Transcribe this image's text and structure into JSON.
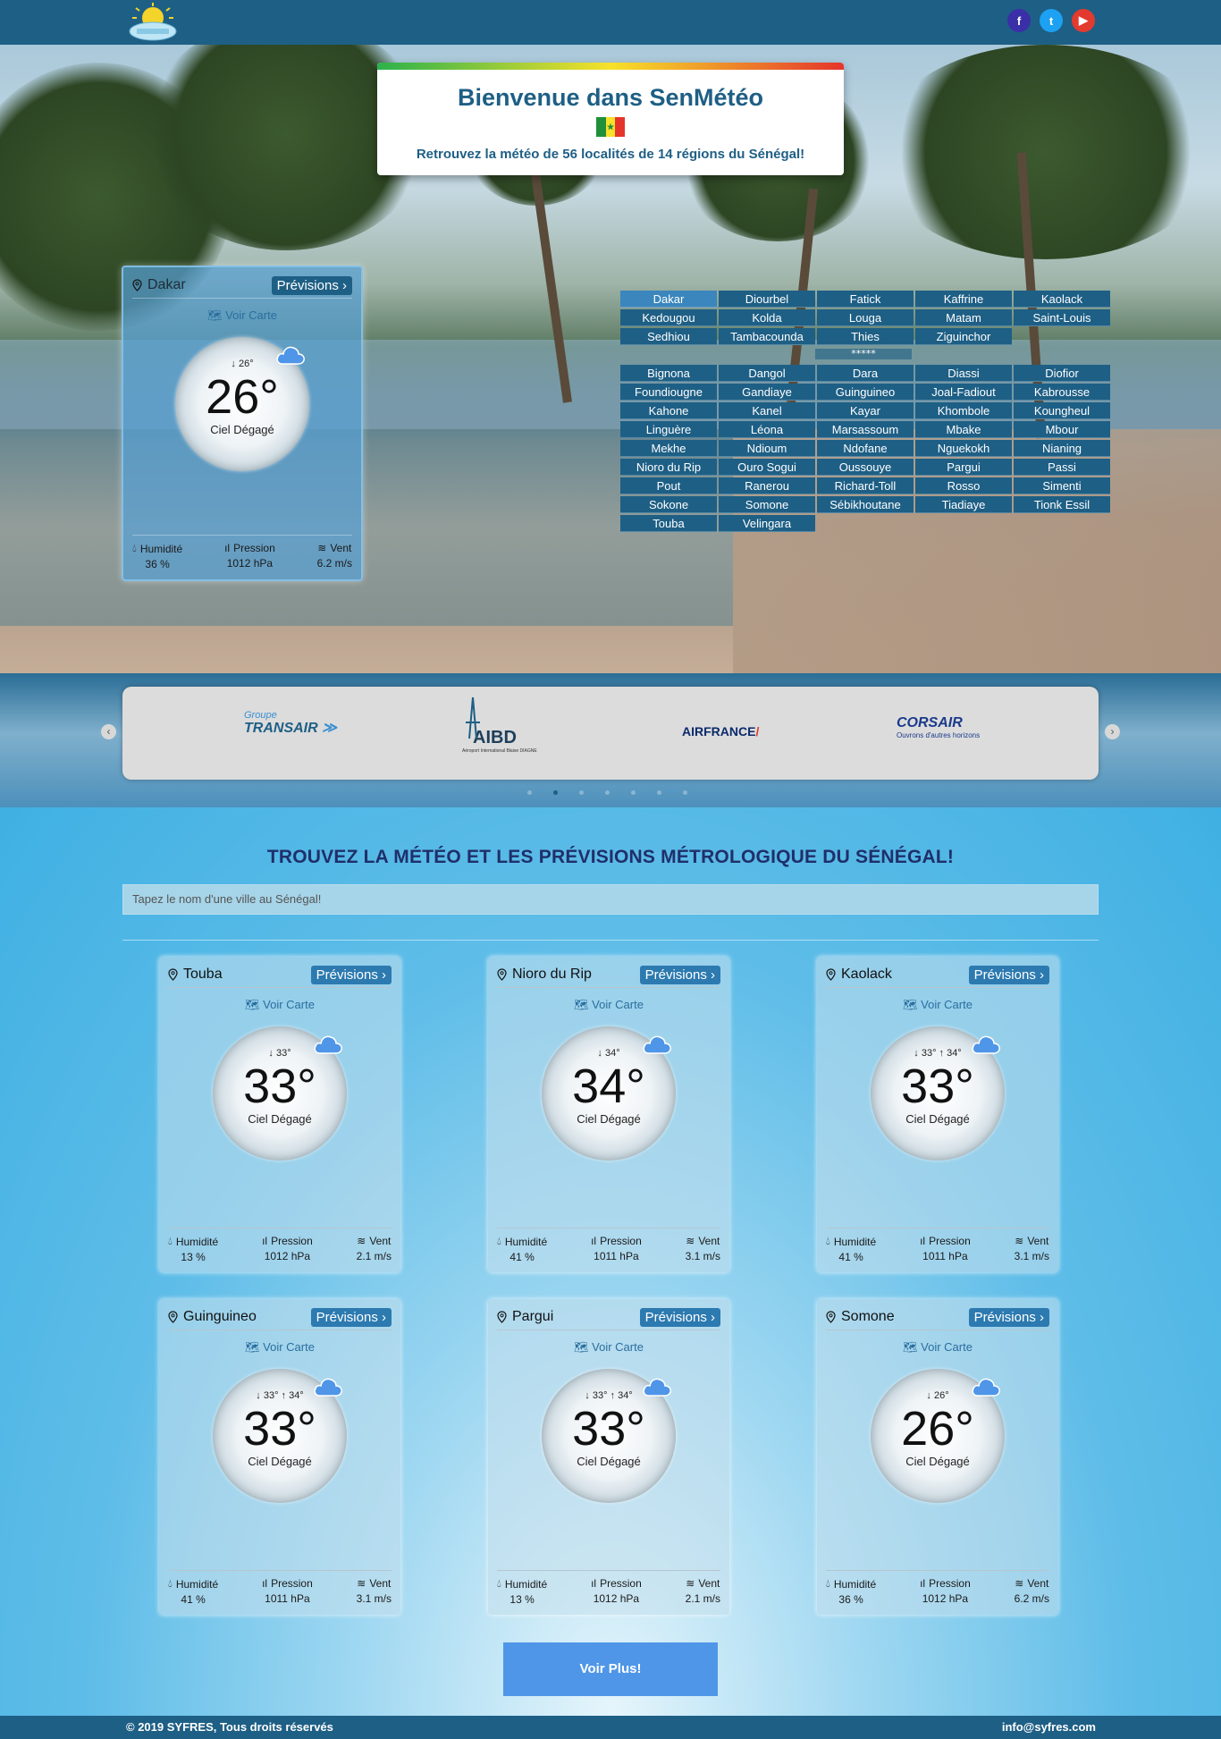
{
  "social": [
    {
      "icon": "facebook-icon",
      "glyph": "f",
      "color": "#3b2fa8"
    },
    {
      "icon": "twitter-icon",
      "glyph": "t",
      "color": "#1da1f2"
    },
    {
      "icon": "youtube-icon",
      "glyph": "▶",
      "color": "#e33a2f"
    }
  ],
  "welcome": {
    "title": "Bienvenue dans SenMétéo",
    "subtitle": "Retrouvez la météo de 56 localités de 14 régions du Sénégal!"
  },
  "regions": [
    "Dakar",
    "Diourbel",
    "Fatick",
    "Kaffrine",
    "Kaolack",
    "Kedougou",
    "Kolda",
    "Louga",
    "Matam",
    "Saint-Louis",
    "Sedhiou",
    "Tambacounda",
    "Thies",
    "Ziguinchor"
  ],
  "separator": "*****",
  "localities": [
    "Bignona",
    "Dangol",
    "Dara",
    "Diassi",
    "Diofior",
    "Foundiougne",
    "Gandiaye",
    "Guinguineo",
    "Joal-Fadiout",
    "Kabrousse",
    "Kahone",
    "Kanel",
    "Kayar",
    "Khombole",
    "Koungheul",
    "Linguère",
    "Léona",
    "Marsassoum",
    "Mbake",
    "Mbour",
    "Mekhe",
    "Ndioum",
    "Ndofane",
    "Nguekokh",
    "Nianing",
    "Nioro du Rip",
    "Ouro Sogui",
    "Oussouye",
    "Pargui",
    "Passi",
    "Pout",
    "Ranerou",
    "Richard-Toll",
    "Rosso",
    "Simenti",
    "Sokone",
    "Somone",
    "Sébikhoutane",
    "Tiadiaye",
    "Tionk Essil",
    "Touba",
    "Velingara"
  ],
  "labels": {
    "previsions": "Prévisions",
    "voir_carte": "Voir Carte",
    "humidite": "Humidité",
    "pression": "Pression",
    "vent": "Vent"
  },
  "hero_card": {
    "city": "Dakar",
    "minmax": "26°",
    "temp": "26°",
    "desc": "Ciel Dégagé",
    "humidity": "36 %",
    "pressure": "1012 hPa",
    "wind": "6.2 m/s"
  },
  "partners": [
    "Groupe",
    "TRANSAIR",
    "AIBD",
    "Aéroport International Blaise DIAGNE",
    "AIRFRANCE",
    "CORSAIR",
    "Ouvrons d'autres horizons"
  ],
  "search": {
    "heading": "TROUVEZ LA MÉTÉO ET LES PRÉVISIONS MÉTROLOGIQUE DU SÉNÉGAL!",
    "placeholder": "Tapez le nom d'une ville au Sénégal!"
  },
  "cards": [
    {
      "city": "Touba",
      "minmax": "33°",
      "temp": "33°",
      "desc": "Ciel Dégagé",
      "humidity": "13 %",
      "pressure": "1012 hPa",
      "wind": "2.1 m/s"
    },
    {
      "city": "Nioro du Rip",
      "minmax": "34°",
      "temp": "34°",
      "desc": "Ciel Dégagé",
      "humidity": "41 %",
      "pressure": "1011 hPa",
      "wind": "3.1 m/s"
    },
    {
      "city": "Kaolack",
      "minmax": "33° ↑ 34°",
      "temp": "33°",
      "desc": "Ciel Dégagé",
      "humidity": "41 %",
      "pressure": "1011 hPa",
      "wind": "3.1 m/s"
    },
    {
      "city": "Guinguineo",
      "minmax": "33° ↑ 34°",
      "temp": "33°",
      "desc": "Ciel Dégagé",
      "humidity": "41 %",
      "pressure": "1011 hPa",
      "wind": "3.1 m/s"
    },
    {
      "city": "Pargui",
      "minmax": "33° ↑ 34°",
      "temp": "33°",
      "desc": "Ciel Dégagé",
      "humidity": "13 %",
      "pressure": "1012 hPa",
      "wind": "2.1 m/s"
    },
    {
      "city": "Somone",
      "minmax": "26°",
      "temp": "26°",
      "desc": "Ciel Dégagé",
      "humidity": "36 %",
      "pressure": "1012 hPa",
      "wind": "6.2 m/s"
    }
  ],
  "voir_plus": "Voir Plus!",
  "footer": {
    "copyright": "© 2019 SYFRES, Tous droits réservés",
    "email": "info@syfres.com"
  },
  "colors": {
    "brand": "#1e5f85",
    "accent": "#2c7ab0",
    "button": "#4f96e8"
  }
}
